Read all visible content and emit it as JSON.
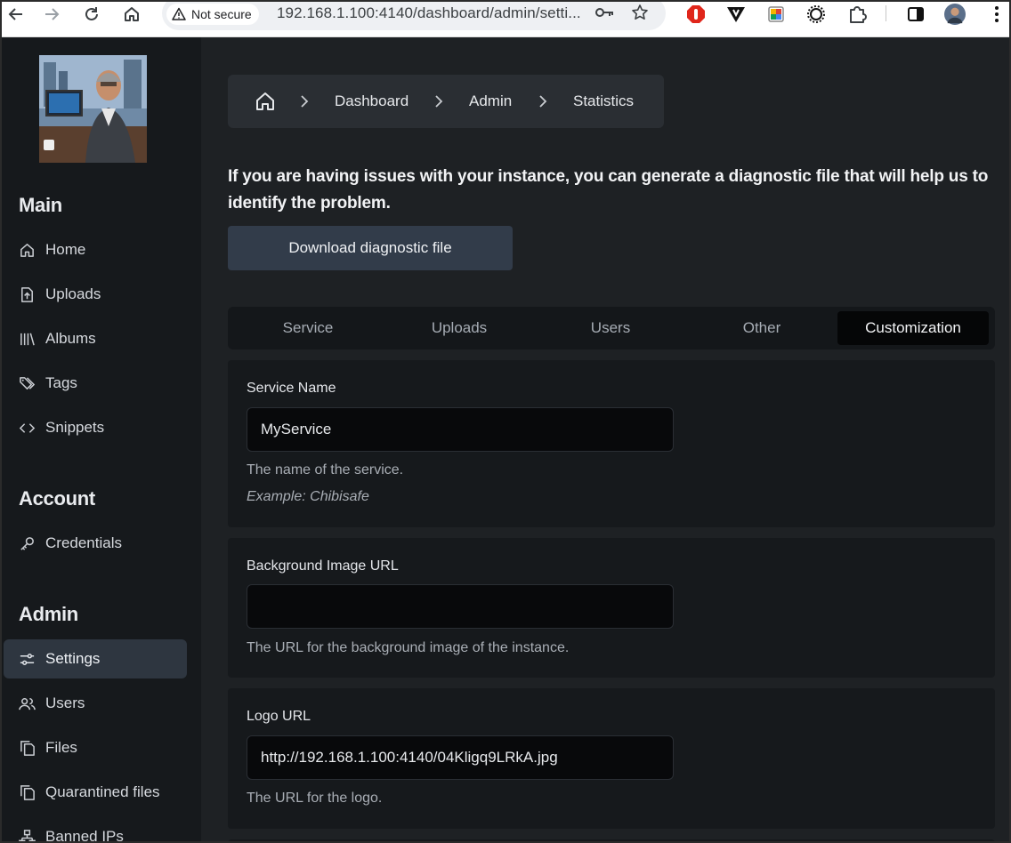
{
  "browser": {
    "security_label": "Not secure",
    "url": "192.168.1.100:4140/dashboard/admin/setti..."
  },
  "sidebar": {
    "sections": [
      {
        "title": "Main",
        "items": [
          {
            "label": "Home",
            "icon": "home-icon"
          },
          {
            "label": "Uploads",
            "icon": "upload-file-icon"
          },
          {
            "label": "Albums",
            "icon": "library-icon"
          },
          {
            "label": "Tags",
            "icon": "tags-icon"
          },
          {
            "label": "Snippets",
            "icon": "code-icon"
          }
        ]
      },
      {
        "title": "Account",
        "items": [
          {
            "label": "Credentials",
            "icon": "key-icon"
          }
        ]
      },
      {
        "title": "Admin",
        "items": [
          {
            "label": "Settings",
            "icon": "sliders-icon",
            "active": true
          },
          {
            "label": "Users",
            "icon": "users-icon"
          },
          {
            "label": "Files",
            "icon": "files-icon"
          },
          {
            "label": "Quarantined files",
            "icon": "files-icon"
          },
          {
            "label": "Banned IPs",
            "icon": "network-icon"
          }
        ]
      }
    ]
  },
  "breadcrumb": [
    "Dashboard",
    "Admin",
    "Statistics"
  ],
  "intro_text": "If you are having issues with your instance, you can generate a diagnostic file that will help us to identify the problem.",
  "diagnostic_button": "Download diagnostic file",
  "tabs": [
    {
      "label": "Service"
    },
    {
      "label": "Uploads"
    },
    {
      "label": "Users"
    },
    {
      "label": "Other"
    },
    {
      "label": "Customization",
      "active": true
    }
  ],
  "fields": [
    {
      "label": "Service Name",
      "value": "MyService",
      "help": "The name of the service.",
      "example": "Example: Chibisafe"
    },
    {
      "label": "Background Image URL",
      "value": "",
      "help": "The URL for the background image of the instance."
    },
    {
      "label": "Logo URL",
      "value": "http://192.168.1.100:4140/04Kligq9LRkA.jpg",
      "help": "The URL for the logo."
    }
  ],
  "colors": {
    "sidebar_bg": "#16191c",
    "main_bg": "#1e2124",
    "active_item_bg": "#2e3640",
    "button_bg": "#323c4a"
  }
}
